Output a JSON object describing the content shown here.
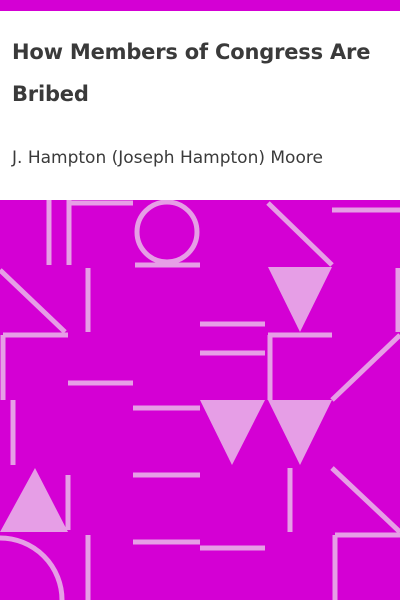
{
  "book": {
    "title": "How Members of Congress Are Bribed",
    "author": "J. Hampton (Joseph Hampton) Moore"
  },
  "colors": {
    "accent": "#d400d4",
    "accent_light": "#e69ee6",
    "background": "#ffffff",
    "text": "#3a3a3a"
  },
  "icons": {
    "pattern": "geometric-pattern-icon"
  }
}
